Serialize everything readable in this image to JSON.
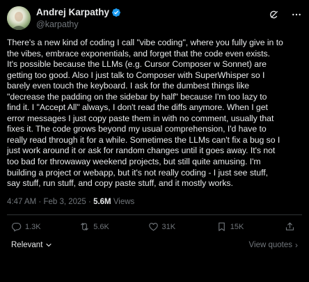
{
  "author": {
    "display_name": "Andrej Karpathy",
    "handle": "@karpathy",
    "verified": true
  },
  "header_icons": [
    "grok-icon",
    "more-icon"
  ],
  "tweet": {
    "lines": [
      "There's a new kind of coding I call \"vibe coding\", where you fully give in to",
      "the vibes, embrace exponentials, and forget that the code even exists.",
      "It's possible because the LLMs (e.g. Cursor Composer w Sonnet) are",
      "getting too good. Also I just talk to Composer with SuperWhisper so I",
      "barely even touch the keyboard. I ask for the dumbest things like",
      "\"decrease the padding on the sidebar by half\" because I'm too lazy to",
      "find it. I \"Accept All\" always, I don't read the diffs anymore. When I get",
      "error messages I just copy paste them in with no comment, usually that",
      "fixes it. The code grows beyond my usual comprehension, I'd have to",
      "really read through it for a while. Sometimes the LLMs can't fix a bug so I",
      "just work around it or ask for random changes until it goes away. It's not",
      "too bad for throwaway weekend projects, but still quite amusing. I'm",
      "building a project or webapp, but it's not really coding - I just see stuff,",
      "say stuff, run stuff, and copy paste stuff, and it mostly works."
    ]
  },
  "meta": {
    "time": "4:47 AM",
    "separator": " · ",
    "date": "Feb 3, 2025",
    "views_count": "5.6M",
    "views_label": " Views"
  },
  "actions": {
    "reply_count": "1.3K",
    "repost_count": "5.6K",
    "like_count": "31K",
    "bookmark_count": "15K"
  },
  "footer": {
    "sort_label": "Relevant",
    "view_quotes_label": "View quotes",
    "view_quotes_chevron": "›"
  },
  "colors": {
    "background": "#000000",
    "text_primary": "#e7e9ea",
    "text_secondary": "#71767b",
    "verified_badge": "#1d9bf0",
    "divider": "#2f3336"
  }
}
